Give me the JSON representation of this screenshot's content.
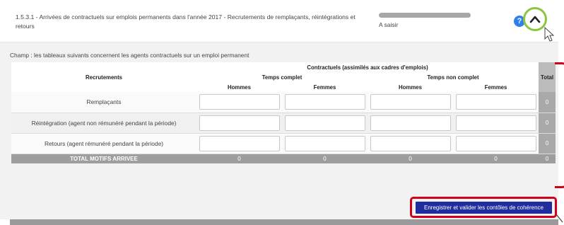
{
  "section": {
    "title": "1.5.3.1 - Arrivées de contractuels sur emplois permanents dans l'année 2017 - Recrutements de remplaçants, réintégrations et retours",
    "status": "A saisir",
    "help_glyph": "?",
    "icons": [
      "help-icon",
      "chevron-up-icon",
      "cursor-icon"
    ]
  },
  "champ": "Champ : les tableaux suivants concernent les agents contractuels sur un emploi permanent",
  "table": {
    "group_header": "Contractuels (assimilés aux cadres d'emplois)",
    "row_header": "Recrutements",
    "temps_complet": "Temps complet",
    "temps_non_complet": "Temps non complet",
    "total_header": "Total",
    "hommes": "Hommes",
    "femmes": "Femmes",
    "rows": [
      {
        "label": "Remplaçants",
        "total": "0"
      },
      {
        "label": "Réintégration (agent non rémunéré pendant la période)",
        "total": "0"
      },
      {
        "label": "Retours (agent rémunéré pendant la période)",
        "total": "0"
      }
    ],
    "totals": {
      "label": "TOTAL MOTIFS ARRIVEE",
      "values": [
        "0",
        "0",
        "0",
        "0",
        "0"
      ]
    }
  },
  "actions": {
    "validate_label": "Enregistrer et valider les contôles de cohérence"
  },
  "colors": {
    "accent_blue": "#1f2d9e",
    "highlight_red": "#d0021b",
    "highlight_green": "#8cc63f",
    "help_blue": "#2f80ed"
  }
}
